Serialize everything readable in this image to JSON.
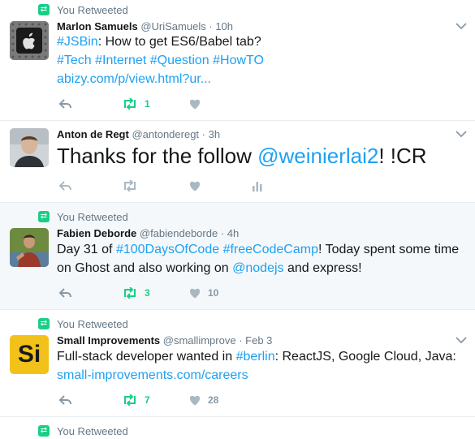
{
  "tweets": [
    {
      "context": "You Retweeted",
      "name": "Marlon Samuels",
      "handle": "@UriSamuels",
      "time": "10h",
      "text": {
        "l1": "#JSBin",
        "t1": ": How to get ES6/Babel tab?",
        "tags": "#Tech #Internet #Question #HowTO",
        "url": "abizy.com/p/view.html?ur..."
      },
      "retweets": "1",
      "likes": "",
      "retweeted": true
    },
    {
      "context": "",
      "name": "Anton de Regt",
      "handle": "@antonderegt",
      "time": "3h",
      "text": {
        "t1": "Thanks for the follow ",
        "mention": "@weinierlai2",
        "t2": "! !CR"
      },
      "retweets": "",
      "likes": "",
      "retweeted": false
    },
    {
      "context": "You Retweeted",
      "name": "Fabien Deborde",
      "handle": "@fabiendeborde",
      "time": "4h",
      "text": {
        "t1": "Day 31 of ",
        "tag1": "#100DaysOfCode",
        "t2": " ",
        "tag2": "#freeCodeCamp",
        "t3": "! Today spent some time on Ghost and also working on ",
        "mention": "@nodejs",
        "t4": " and express!"
      },
      "retweets": "3",
      "likes": "10",
      "retweeted": true
    },
    {
      "context": "You Retweeted",
      "name": "Small Improvements",
      "handle": "@smallimprove",
      "time": "Feb 3",
      "avatar_text": "Si",
      "text": {
        "t1": "Full-stack developer wanted in ",
        "tag": "#berlin",
        "t2": ": ReactJS, Google Cloud, Java:",
        "url": "small-improvements.com/careers"
      },
      "retweets": "7",
      "likes": "28",
      "retweeted": true
    },
    {
      "context": "You Retweeted"
    }
  ],
  "dot": "·",
  "colors": {
    "link": "#1da1f2",
    "retweet_green": "#19cf86",
    "muted": "#657786",
    "highlight_bg": "#f5f8fa"
  },
  "icons": [
    "retweet-context-icon",
    "reply-icon",
    "retweet-icon",
    "like-icon",
    "analytics-icon",
    "chevron-down-icon"
  ]
}
